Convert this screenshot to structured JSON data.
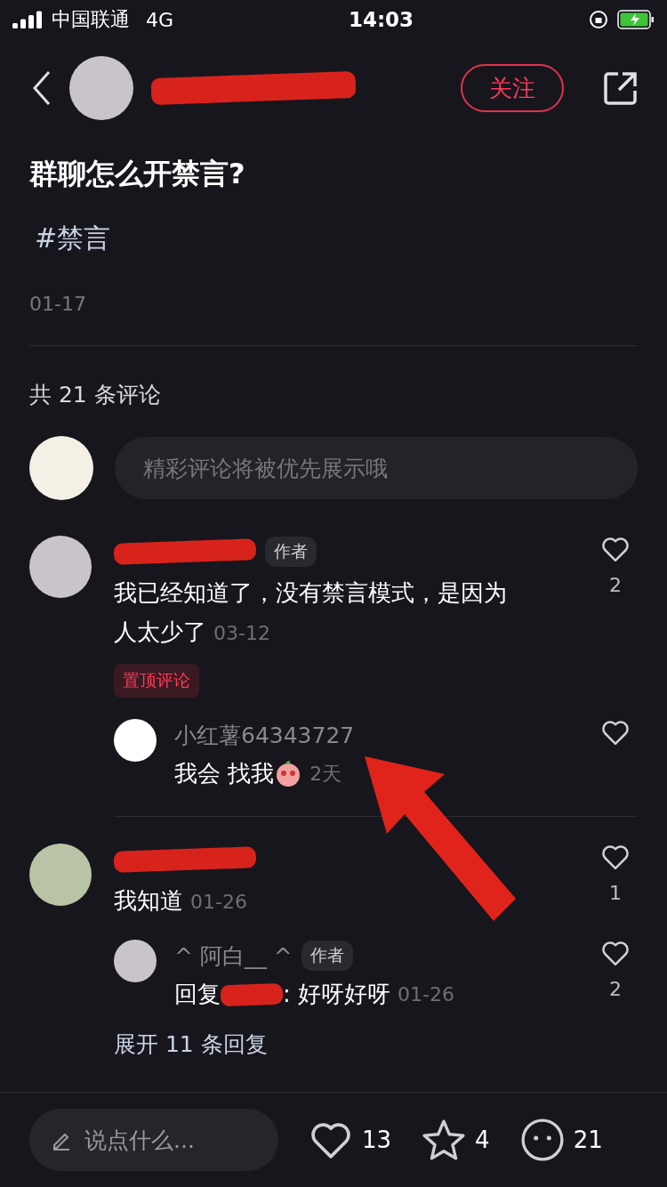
{
  "status_bar": {
    "carrier": "中国联通",
    "network": "4G",
    "time": "14:03"
  },
  "header": {
    "author_redacted": true,
    "follow_label": "关注"
  },
  "post": {
    "title": "群聊怎么开禁言?",
    "tag": "#禁言",
    "date": "01-17"
  },
  "comments_count": "共 21 条评论",
  "comment_input": {
    "placeholder": "精彩评论将被优先展示哦"
  },
  "comments": [
    {
      "color": "#c9c4cc",
      "redacted": true,
      "badge": "作者",
      "text": "我已经知道了，没有禁言模式，是因为人太少了",
      "time": "03-12",
      "likes": "2",
      "pinned_label": "置顶评论",
      "replies": [
        {
          "color": "#ffffff",
          "name": "小红薯64343727",
          "redacted": false,
          "reply_to_redacted": false,
          "text": "我会 找我",
          "emoji": true,
          "time": "2天"
        }
      ]
    },
    {
      "color": "#b9c4a6",
      "redacted": true,
      "text": "我知道",
      "time": "01-26",
      "likes": "1",
      "replies": [
        {
          "color": "#c9c4cc",
          "name": "^ 阿白__ ^",
          "redacted": false,
          "badge": "作者",
          "reply_prefix": "回复",
          "reply_to_redacted": true,
          "text": ": 好呀好呀",
          "emoji": false,
          "time": "01-26",
          "likes": "2"
        }
      ],
      "expand_label": "展开 11 条回复"
    }
  ],
  "bottom_bar": {
    "placeholder": "说点什么...",
    "likes": "13",
    "favorites": "4",
    "comments": "21"
  }
}
